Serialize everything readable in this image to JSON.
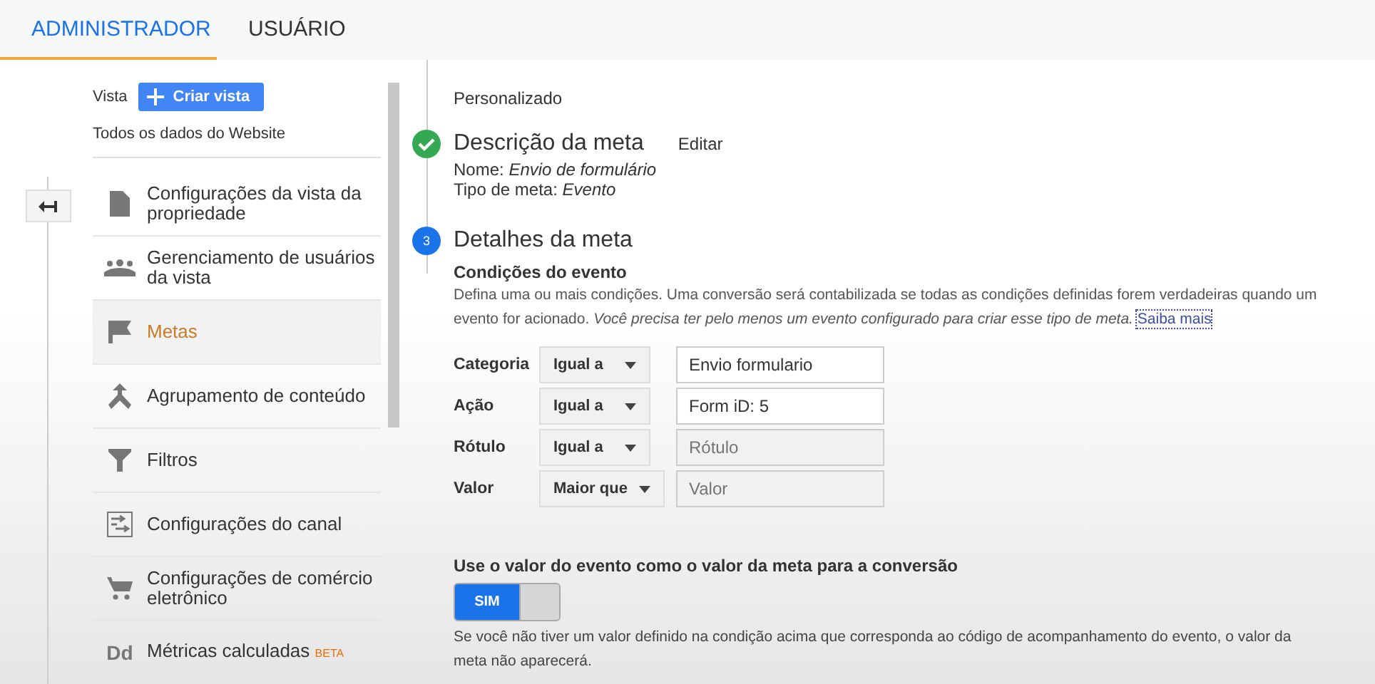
{
  "tabs": [
    {
      "label": "ADMINISTRADOR",
      "selected": true
    },
    {
      "label": "USUÁRIO",
      "selected": false
    }
  ],
  "sidebar": {
    "view_label": "Vista",
    "create_button": "Criar vista",
    "view_name": "Todos os dados do Website",
    "items": [
      {
        "label": "Configurações da vista da propriedade",
        "kind": "document",
        "selected": false
      },
      {
        "label": "Gerenciamento de usuários da vista",
        "kind": "people",
        "selected": false
      },
      {
        "label": "Metas",
        "kind": "flag",
        "selected": true
      },
      {
        "label": "Agrupamento de conteúdo",
        "kind": "merge",
        "selected": false
      },
      {
        "label": "Filtros",
        "kind": "filter",
        "selected": false
      },
      {
        "label": "Configurações do canal",
        "kind": "channel",
        "selected": false
      },
      {
        "label": "Configurações de comércio eletrônico",
        "kind": "cart",
        "selected": false
      },
      {
        "label": "Métricas calculadas",
        "kind": "text",
        "icon_text": "Dd",
        "badge": "BETA",
        "selected": false
      }
    ]
  },
  "main": {
    "step_prev": "Personalizado",
    "steps": [
      {
        "kind": "done",
        "title": "Descrição da meta",
        "action": "Editar",
        "details": [
          "Nome: *Envio de formulário*",
          "Tipo de meta: *Evento*"
        ]
      },
      {
        "kind": "current",
        "number": "3",
        "title": "Detalhes da meta"
      }
    ],
    "conditions": {
      "heading": "Condições do evento",
      "description": "Defina uma ou mais condições. Uma conversão será contabilizada se todas as condições definidas forem verdadeiras quando um evento for acionado. *Você precisa ter pelo menos um evento configurado para criar esse tipo de meta.*",
      "link": "Saiba mais",
      "rows": [
        {
          "label": "Categoria",
          "operator": "Igual a",
          "value": "Envio formulario"
        },
        {
          "label": "Ação",
          "operator": "Igual a",
          "value": "Form iD: 5"
        },
        {
          "label": "Rótulo",
          "operator": "Igual a",
          "placeholder": "Rótulo"
        },
        {
          "label": "Valor",
          "operator": "Maior que",
          "placeholder": "Valor"
        }
      ]
    },
    "value_toggle": {
      "heading": "Use o valor do evento como o valor da meta para a conversão",
      "label": "SIM",
      "on": true,
      "note": "Se você não tiver um valor definido na condição acima que corresponda ao código de acompanhamento do evento, o valor da meta não aparecerá."
    }
  }
}
